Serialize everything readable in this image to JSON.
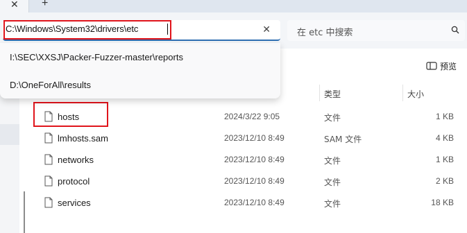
{
  "tabs": {
    "close_glyph": "✕",
    "new_tab_glyph": "+"
  },
  "address_bar": {
    "value": "C:\\Windows\\System32\\drivers\\etc",
    "clear_glyph": "✕",
    "highlight_color": "#e0141b"
  },
  "search": {
    "placeholder": "在 etc 中搜索"
  },
  "suggestions": [
    "I:\\SEC\\XXSJ\\Packer-Fuzzer-master\\reports",
    "D:\\OneForAll\\results"
  ],
  "toolbar": {
    "preview_label": "预览"
  },
  "columns": {
    "type": "类型",
    "size": "大小"
  },
  "files": [
    {
      "name": "hosts",
      "date": "2024/3/22 9:05",
      "type": "文件",
      "size": "1 KB"
    },
    {
      "name": "lmhosts.sam",
      "date": "2023/12/10 8:49",
      "type": "SAM 文件",
      "size": "4 KB"
    },
    {
      "name": "networks",
      "date": "2023/12/10 8:49",
      "type": "文件",
      "size": "1 KB"
    },
    {
      "name": "protocol",
      "date": "2023/12/10 8:49",
      "type": "文件",
      "size": "2 KB"
    },
    {
      "name": "services",
      "date": "2023/12/10 8:49",
      "type": "文件",
      "size": "18 KB"
    }
  ]
}
